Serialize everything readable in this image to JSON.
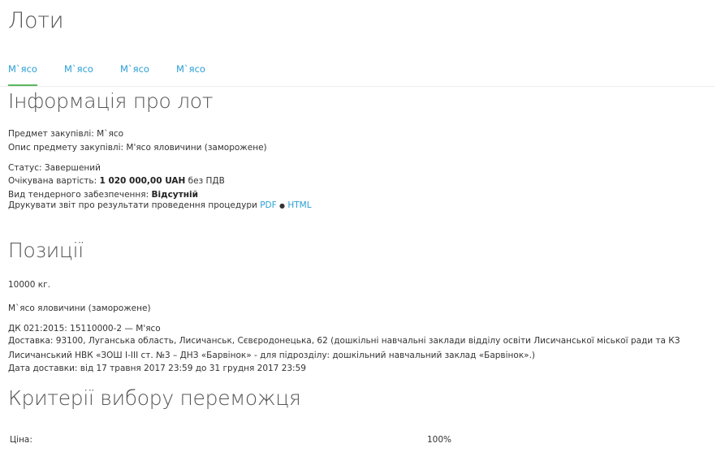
{
  "page_title": "Лоти",
  "tabs": [
    {
      "label": "М`ясо"
    },
    {
      "label": "М`ясо"
    },
    {
      "label": "М`ясо"
    },
    {
      "label": "М`ясо"
    }
  ],
  "lot_info": {
    "heading": "Інформація про лот",
    "subject_label": "Предмет закупівлі:",
    "subject_value": "М`ясо",
    "description_label": "Опис предмету закупівлі:",
    "description_value": "М'ясо яловичини (заморожене)",
    "status_label": "Статус:",
    "status_value": "Завершений",
    "expected_cost_label": "Очікувана вартість:",
    "expected_cost_value": "1 020 000,00 UAH",
    "expected_cost_suffix": "без ПДВ",
    "security_label": "Вид тендерного забезпечення:",
    "security_value": "Відсутній",
    "print_report_label": "Друкувати звіт про результати проведення процедури",
    "print_pdf": "PDF",
    "print_separator": "●",
    "print_html": "HTML"
  },
  "positions": {
    "heading": "Позиції",
    "quantity": "10000 кг.",
    "item_name": "М`ясо яловичини (заморожене)",
    "classifier": "ДК 021:2015: 15110000-2 — М'ясо",
    "delivery_line1": "Доставка: 93100, Луганська область, Лисичанськ, Сєвєродонецька, 62 (дошкільні навчальні заклади відділу освіти Лисичанської міської ради та КЗ",
    "delivery_line2": "Лисичанський НВК «ЗОШ І-ІІІ ст. №3 – ДНЗ «Барвінок» - для підрозділу: дошкільний навчальний заклад «Барвінок».)",
    "delivery_date": "Дата доставки: від 17 травня 2017 23:59 до 31 грудня 2017 23:59"
  },
  "criteria": {
    "heading": "Критерії вибору переможця",
    "price_label": "Ціна:",
    "price_value": "100%"
  }
}
